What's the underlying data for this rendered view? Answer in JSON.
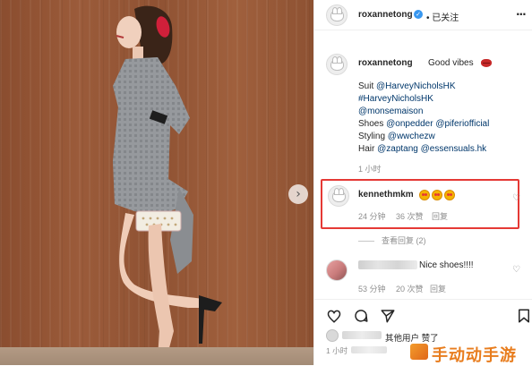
{
  "header": {
    "username": "roxannetong",
    "separator": "•",
    "follow_status": "已关注"
  },
  "caption": {
    "username": "roxannetong",
    "text": "Good vibes",
    "line1_prefix": "Suit ",
    "line1_link": "@HarveyNicholsHK",
    "line2_link": "#HarveyNicholsHK",
    "line3_link": "@monsemaison",
    "line4_prefix": "Shoes ",
    "line4_link1": "@onpedder",
    "line4_link2": "@piferiofficial",
    "line5_prefix": "Styling ",
    "line5_link": "@wwchezw",
    "line6_prefix": "Hair ",
    "line6_link1": "@zaptang",
    "line6_link2": "@essensuals.hk",
    "time": "1 小时"
  },
  "comment1": {
    "username": "kennethmkm",
    "time": "24 分钟",
    "likes": "36 次赞",
    "reply": "回复",
    "view_replies": "查看回复 (2)"
  },
  "comment2": {
    "text": "Nice shoes!!!!",
    "time": "53 分钟",
    "likes": "20 次赞",
    "reply": "回复"
  },
  "footer": {
    "likes_text": "其他用户 赞了",
    "time": "1 小时"
  },
  "watermark": "手动动手游",
  "colors": {
    "link": "#00376b",
    "highlight_border": "#e53935",
    "verified": "#3897f0",
    "meta_gray": "#8e8e8e",
    "wall": "#8f5233"
  },
  "icons": [
    "next-arrow-icon",
    "verified-badge-icon",
    "more-options-icon",
    "lips-emoji-icon",
    "heart-eyes-emoji-icon",
    "heart-icon",
    "comment-icon",
    "share-icon",
    "bookmark-icon"
  ]
}
